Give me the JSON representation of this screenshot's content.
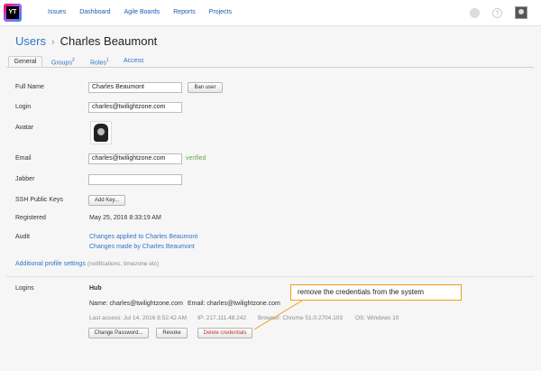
{
  "header": {
    "logo_text": "YT",
    "nav": [
      "Issues",
      "Dashboard",
      "Agile Boards",
      "Reports",
      "Projects"
    ],
    "help_icon": "?"
  },
  "breadcrumb": {
    "parent": "Users",
    "separator": "›",
    "current": "Charles Beaumont"
  },
  "tabs": [
    {
      "label": "General",
      "count": ""
    },
    {
      "label": "Groups",
      "count": "2"
    },
    {
      "label": "Roles",
      "count": "1"
    },
    {
      "label": "Access",
      "count": ""
    }
  ],
  "form": {
    "full_name_label": "Full Name",
    "full_name_value": "Charles Beaumont",
    "ban_button": "Ban user",
    "login_label": "Login",
    "login_value": "charles@twilightzone.com",
    "avatar_label": "Avatar",
    "email_label": "Email",
    "email_value": "charles@twilightzone.com",
    "email_status": "verified",
    "jabber_label": "Jabber",
    "jabber_value": "",
    "ssh_label": "SSH Public Keys",
    "add_key_button": "Add Key...",
    "registered_label": "Registered",
    "registered_value": "May 25, 2016 8:33:19 AM",
    "audit_label": "Audit",
    "audit_link_1": "Changes applied to Charles Beaumont",
    "audit_link_2": "Changes made by Charles Beaumont",
    "additional_link": "Additional profile settings",
    "additional_note": "(notifications, timezone etc)"
  },
  "logins": {
    "label": "Logins",
    "service": "Hub",
    "name_text": "Name: charles@twilightzone.com",
    "email_text": "Email: charles@twilightzone.com",
    "last_access": "Last access: Jul 14, 2016 8:52:42 AM",
    "ip": "IP: 217.111.48.242",
    "browser": "Browser: Chrome 51.0.2704.103",
    "os": "OS: Windows 10",
    "change_password_button": "Change Password...",
    "revoke_button": "Revoke",
    "delete_button": "Delete credentials"
  },
  "callout": {
    "text": "remove the credentials from the system"
  },
  "colors": {
    "link": "#2e76c7",
    "verified": "#6aa84f",
    "delete": "#c0392b",
    "callout_border": "#f39a1a"
  }
}
